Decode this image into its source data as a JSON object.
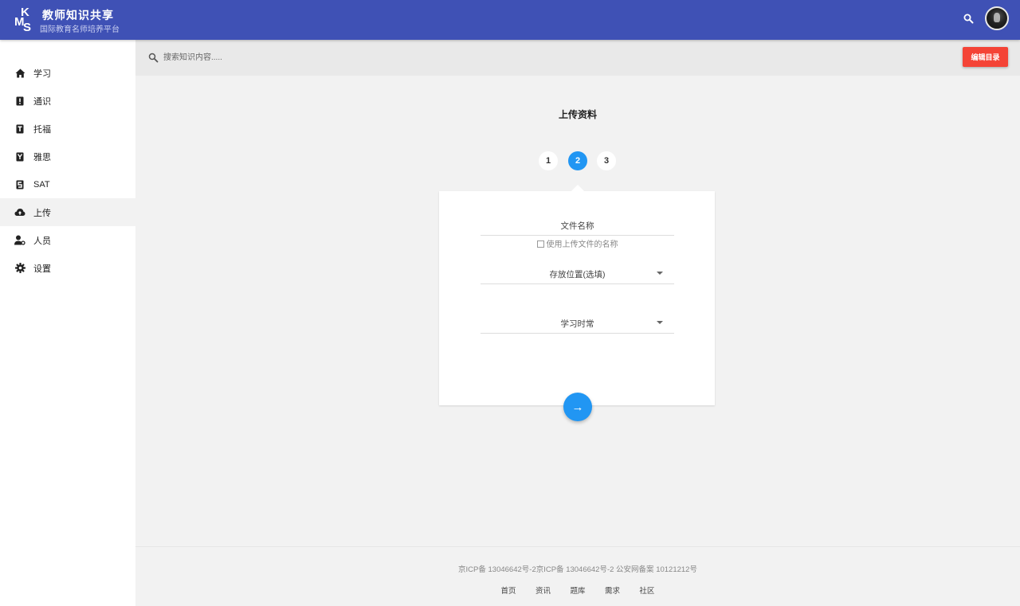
{
  "header": {
    "logo": {
      "k": "K",
      "m": "M",
      "s": "S"
    },
    "title": "教师知识共享",
    "subtitle": "国际教育名师培养平台"
  },
  "sidebar": {
    "items": [
      {
        "label": "学习",
        "icon": "home-icon"
      },
      {
        "label": "通识",
        "icon": "book-icon"
      },
      {
        "label": "托福",
        "icon": "book-icon"
      },
      {
        "label": "雅思",
        "icon": "book-icon"
      },
      {
        "label": "SAT",
        "icon": "book-icon"
      },
      {
        "label": "上传",
        "icon": "cloud-upload-icon",
        "active": true
      },
      {
        "label": "人员",
        "icon": "person-icon"
      },
      {
        "label": "设置",
        "icon": "gear-icon"
      }
    ]
  },
  "search": {
    "placeholder": "搜索知识内容....."
  },
  "toolbar": {
    "edit_label": "编辑目录"
  },
  "main": {
    "title": "上传资料",
    "steps": [
      "1",
      "2",
      "3"
    ],
    "active_step": 2,
    "form": {
      "filename_placeholder": "文件名称",
      "use_upload_name_label": "使用上传文件的名称",
      "location_label": "存放位置(选填)",
      "study_time_label": "学习时常"
    },
    "next_symbol": "→"
  },
  "footer": {
    "copyright": "京ICP备 13046642号-2京ICP备 13046642号-2 公安网备案  10121212号",
    "links": [
      "首页",
      "资讯",
      "题库",
      "需求",
      "社区"
    ]
  },
  "colors": {
    "primary": "#3f51b5",
    "accent": "#2196f3",
    "danger": "#f44336"
  }
}
